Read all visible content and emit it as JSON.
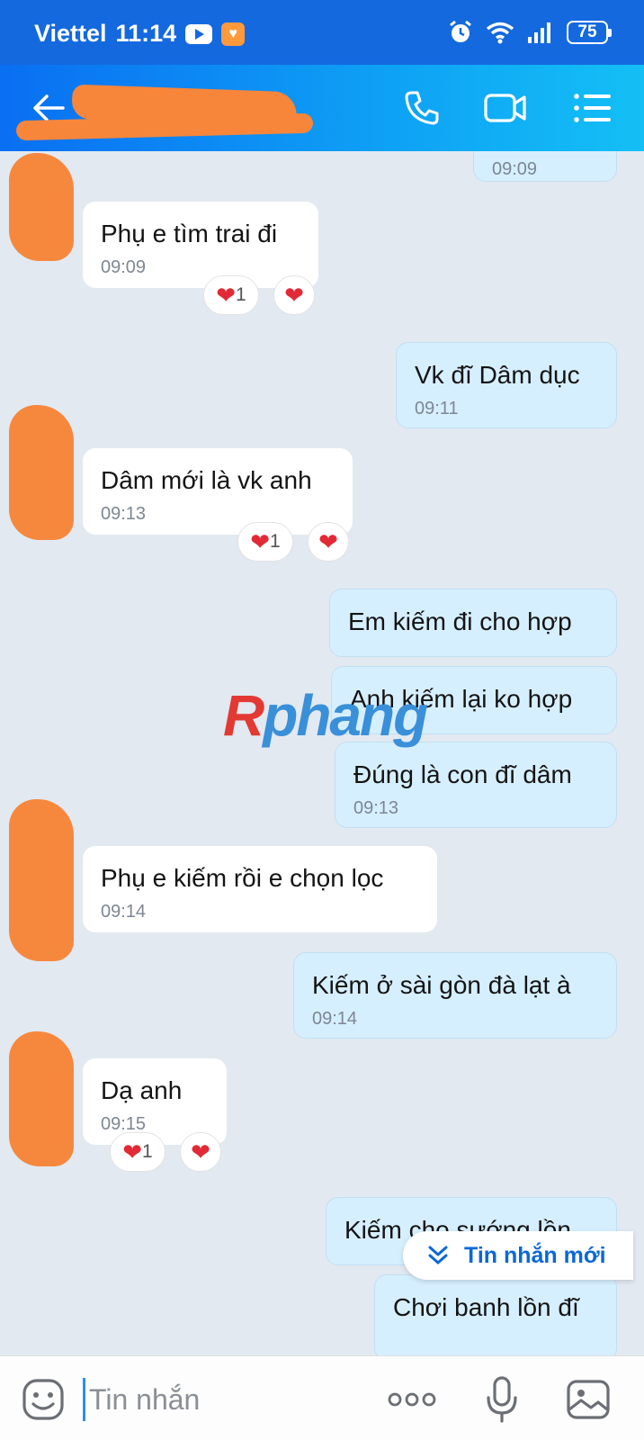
{
  "status_bar": {
    "carrier": "Viettel",
    "time": "11:14",
    "battery": "75",
    "icons": [
      "youtube-icon",
      "app-notification-icon",
      "alarm-icon",
      "wifi-icon",
      "signal-icon",
      "battery-icon"
    ]
  },
  "header": {
    "icons": [
      "back-arrow-icon",
      "phone-icon",
      "video-call-icon",
      "menu-list-icon"
    ]
  },
  "messages": [
    {
      "side": "out",
      "text": "",
      "time": "09:09"
    },
    {
      "side": "in",
      "text": "Phụ e tìm trai đi",
      "time": "09:09",
      "reaction_count": "1"
    },
    {
      "side": "out",
      "text": "Vk đĩ Dâm dục",
      "time": "09:11"
    },
    {
      "side": "in",
      "text": "Dâm mới là vk anh",
      "time": "09:13",
      "reaction_count": "1"
    },
    {
      "side": "out",
      "text": "Em kiếm đi cho hợp",
      "time": ""
    },
    {
      "side": "out",
      "text": "Anh kiếm lại ko hợp",
      "time": ""
    },
    {
      "side": "out",
      "text": "Đúng là con đĩ dâm",
      "time": "09:13"
    },
    {
      "side": "in",
      "text": "Phụ e kiếm rồi e chọn lọc",
      "time": "09:14"
    },
    {
      "side": "out",
      "text": "Kiếm ở sài gòn đà lạt à",
      "time": "09:14"
    },
    {
      "side": "in",
      "text": "Dạ anh",
      "time": "09:15",
      "reaction_count": "1"
    },
    {
      "side": "out",
      "text": "Kiếm cho sướng lồn",
      "time": ""
    },
    {
      "side": "out",
      "text": "Chơi banh lồn đĩ",
      "time": ""
    }
  ],
  "watermark": {
    "part1": "R",
    "part2": "phang"
  },
  "new_message_button": {
    "label": "Tin nhắn mới"
  },
  "composer": {
    "placeholder": "Tin nhắn"
  },
  "colors": {
    "header": "#0a8ef2",
    "outgoing_bubble": "#d6efff",
    "incoming_bubble": "#ffffff",
    "background": "#e2e9f1",
    "accent": "#0a68d8"
  }
}
